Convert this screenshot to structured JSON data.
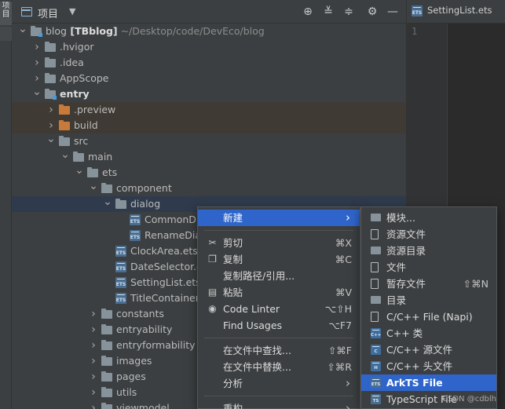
{
  "left_strip": {
    "tab1": "项目",
    "tab2": ""
  },
  "header": {
    "title": "项目",
    "dropdown_icon": "caret-down"
  },
  "tree": [
    {
      "name": "blog",
      "bold_suffix": " [TBblog]",
      "hint": " ~/Desktop/code/DevEco/blog",
      "indent": 0,
      "chevron": "down",
      "icon": "folder-module"
    },
    {
      "name": ".hvigor",
      "indent": 1,
      "chevron": "right",
      "icon": "folder"
    },
    {
      "name": ".idea",
      "indent": 1,
      "chevron": "right",
      "icon": "folder"
    },
    {
      "name": "AppScope",
      "indent": 1,
      "chevron": "right",
      "icon": "folder"
    },
    {
      "name": "entry",
      "indent": 1,
      "chevron": "down",
      "icon": "folder-module",
      "bold": true
    },
    {
      "name": ".preview",
      "indent": 2,
      "chevron": "right",
      "icon": "folder-orange",
      "shaded": true
    },
    {
      "name": "build",
      "indent": 2,
      "chevron": "right",
      "icon": "folder-orange",
      "shaded": true
    },
    {
      "name": "src",
      "indent": 2,
      "chevron": "down",
      "icon": "folder"
    },
    {
      "name": "main",
      "indent": 3,
      "chevron": "down",
      "icon": "folder"
    },
    {
      "name": "ets",
      "indent": 4,
      "chevron": "down",
      "icon": "folder"
    },
    {
      "name": "component",
      "indent": 5,
      "chevron": "down",
      "icon": "folder"
    },
    {
      "name": "dialog",
      "indent": 6,
      "chevron": "down",
      "icon": "folder",
      "selected": true
    },
    {
      "name": "CommonDia",
      "indent": 7,
      "chevron": "",
      "icon": "ets"
    },
    {
      "name": "RenameDia",
      "indent": 7,
      "chevron": "",
      "icon": "ets"
    },
    {
      "name": "ClockArea.ets",
      "indent": 6,
      "chevron": "",
      "icon": "ets"
    },
    {
      "name": "DateSelector.e",
      "indent": 6,
      "chevron": "",
      "icon": "ets"
    },
    {
      "name": "SettingList.ets",
      "indent": 6,
      "chevron": "",
      "icon": "ets"
    },
    {
      "name": "TitleContainer.",
      "indent": 6,
      "chevron": "",
      "icon": "ets"
    },
    {
      "name": "constants",
      "indent": 5,
      "chevron": "right",
      "icon": "folder"
    },
    {
      "name": "entryability",
      "indent": 5,
      "chevron": "right",
      "icon": "folder"
    },
    {
      "name": "entryformability",
      "indent": 5,
      "chevron": "right",
      "icon": "folder"
    },
    {
      "name": "images",
      "indent": 5,
      "chevron": "right",
      "icon": "folder"
    },
    {
      "name": "pages",
      "indent": 5,
      "chevron": "right",
      "icon": "folder"
    },
    {
      "name": "utils",
      "indent": 5,
      "chevron": "right",
      "icon": "folder"
    },
    {
      "name": "viewmodel",
      "indent": 5,
      "chevron": "right",
      "icon": "folder"
    }
  ],
  "editor": {
    "tab_label": "SettingList.ets",
    "line_number": "1"
  },
  "context_menu": {
    "items": [
      {
        "label": "新建",
        "shortcut": "",
        "submenu": true,
        "icon": "",
        "active": true
      },
      {
        "separator": true
      },
      {
        "label": "剪切",
        "shortcut": "⌘X",
        "icon": "scissors-icon"
      },
      {
        "label": "复制",
        "shortcut": "⌘C",
        "icon": "copy-icon"
      },
      {
        "label": "复制路径/引用...",
        "shortcut": "",
        "icon": ""
      },
      {
        "label": "粘贴",
        "shortcut": "⌘V",
        "icon": "clipboard-icon"
      },
      {
        "label": "Code Linter",
        "shortcut": "⌥⇧H",
        "icon": "linter-icon"
      },
      {
        "label": "Find Usages",
        "shortcut": "⌥F7",
        "icon": ""
      },
      {
        "separator": true
      },
      {
        "label": "在文件中查找...",
        "shortcut": "⇧⌘F",
        "icon": ""
      },
      {
        "label": "在文件中替换...",
        "shortcut": "⇧⌘R",
        "icon": ""
      },
      {
        "label": "分析",
        "shortcut": "",
        "submenu": true,
        "icon": ""
      },
      {
        "separator": true
      },
      {
        "label": "重构",
        "shortcut": "",
        "submenu": true,
        "icon": ""
      }
    ]
  },
  "submenu": {
    "items": [
      {
        "label": "模块...",
        "shortcut": "",
        "icon": "module-icon"
      },
      {
        "label": "资源文件",
        "shortcut": "",
        "icon": "resource-file-icon"
      },
      {
        "label": "资源目录",
        "shortcut": "",
        "icon": "folder-icon"
      },
      {
        "label": "文件",
        "shortcut": "",
        "icon": "file-icon"
      },
      {
        "label": "暂存文件",
        "shortcut": "⇧⌘N",
        "icon": "scratch-file-icon"
      },
      {
        "label": "目录",
        "shortcut": "",
        "icon": "folder-icon"
      },
      {
        "label": "C/C++ File (Napi)",
        "shortcut": "",
        "icon": "napi-icon"
      },
      {
        "label": "C++ 类",
        "shortcut": "",
        "icon": "cpp-class-icon"
      },
      {
        "label": "C/C++ 源文件",
        "shortcut": "",
        "icon": "cpp-source-icon"
      },
      {
        "label": "C/C++ 头文件",
        "shortcut": "",
        "icon": "cpp-header-icon"
      },
      {
        "label": "ArkTS File",
        "shortcut": "",
        "icon": "arkts-icon",
        "active": true
      },
      {
        "label": "TypeScript File",
        "shortcut": "",
        "icon": "ts-icon"
      }
    ]
  },
  "watermark": "CSDN @cdblh"
}
